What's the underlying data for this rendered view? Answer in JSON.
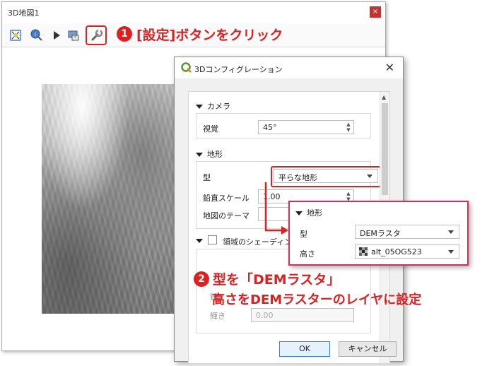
{
  "map_window": {
    "title": "3D地図1",
    "close_symbol": "×",
    "toolbar": {
      "buttons": [
        "zoom-full-icon",
        "identify-icon",
        "play-icon",
        "save-image-icon",
        "settings-icon"
      ]
    }
  },
  "callout1": {
    "number": "1",
    "text": "[設定]ボタンをクリック"
  },
  "dialog": {
    "title": "3Dコンフィグレーション",
    "close_symbol": "✕",
    "camera": {
      "header": "カメラ",
      "fov_label": "視覚",
      "fov_value": "45°"
    },
    "terrain": {
      "header": "地形",
      "type_label": "型",
      "type_value": "平らな地形",
      "vertical_scale_label": "鉛直スケール",
      "vertical_scale_value": "1.00",
      "map_theme_label": "地図のテーマ"
    },
    "shading": {
      "header": "領域のシェーディング",
      "mirror_label": "鏡",
      "shininess_label": "輝き",
      "shininess_value": "0.00"
    },
    "ok_label": "OK",
    "cancel_label": "キャンセル"
  },
  "popup": {
    "header": "地形",
    "type_label": "型",
    "type_value": "DEMラスタ",
    "height_label": "高さ",
    "height_value": "alt_05OG523"
  },
  "callout2": {
    "number": "2",
    "line1": "型を「DEMラスタ」",
    "line2": "高さをDEMラスターのレイヤに設定"
  },
  "colors": {
    "accent_red": "#e02020",
    "popup_border": "#d03060",
    "ok_border": "#3c7fd6"
  }
}
